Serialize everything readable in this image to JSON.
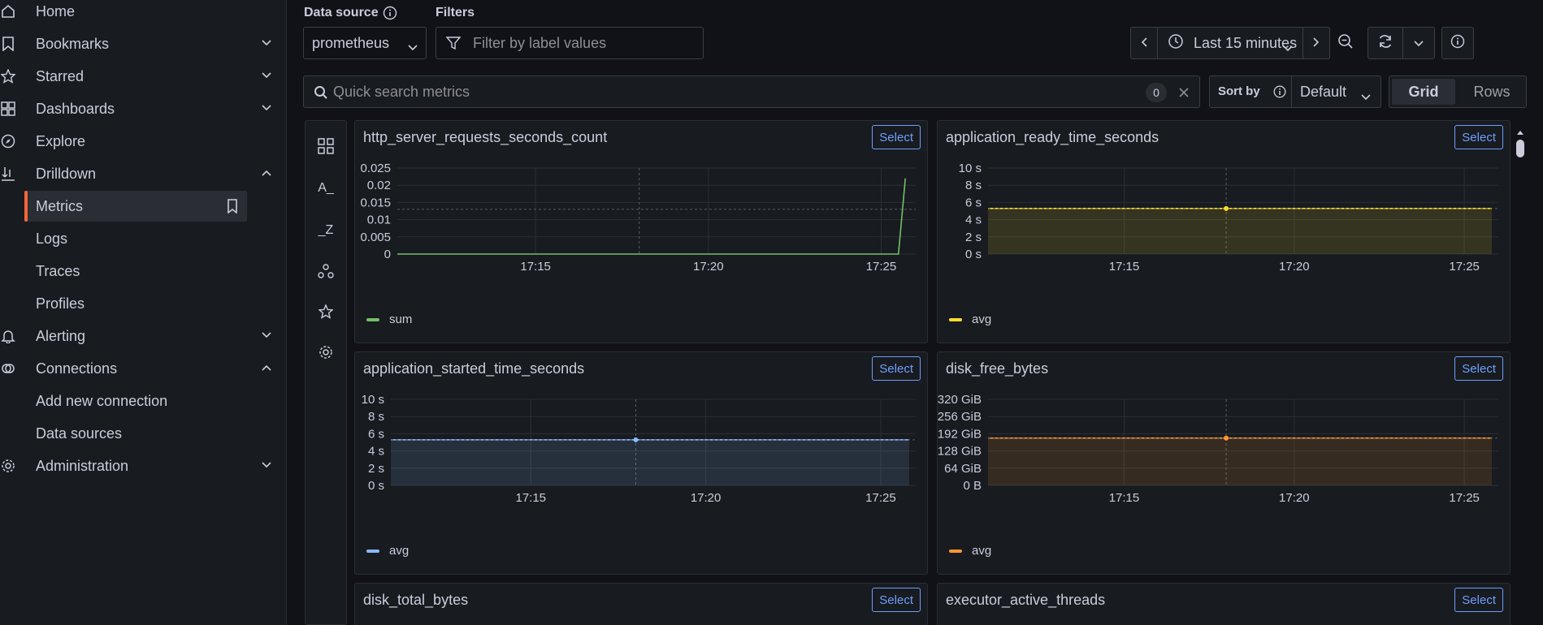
{
  "sidebar": {
    "items": [
      {
        "label": "Home",
        "icon": "home-icon"
      },
      {
        "label": "Bookmarks",
        "icon": "bookmark-icon"
      },
      {
        "label": "Starred",
        "icon": "star-icon"
      },
      {
        "label": "Dashboards",
        "icon": "dashboards-icon"
      },
      {
        "label": "Explore",
        "icon": "compass-icon"
      },
      {
        "label": "Drilldown",
        "icon": "drilldown-icon"
      },
      {
        "label": "Alerting",
        "icon": "bell-icon"
      },
      {
        "label": "Connections",
        "icon": "connections-icon"
      },
      {
        "label": "Administration",
        "icon": "gear-icon"
      }
    ],
    "drilldown_sub": [
      "Metrics",
      "Logs",
      "Traces",
      "Profiles"
    ],
    "connections_sub": [
      "Add new connection",
      "Data sources"
    ]
  },
  "toolbar": {
    "datasource_label": "Data source",
    "datasource_value": "prometheus",
    "filters_label": "Filters",
    "filters_placeholder": "Filter by label values",
    "time_range": "Last 15 minutes",
    "search_placeholder": "Quick search metrics",
    "search_count": "0",
    "sort_label": "Sort by",
    "sort_value": "Default",
    "view_grid": "Grid",
    "view_rows": "Rows"
  },
  "rail": {
    "icons": [
      "grid-icon",
      "a-to-z-icon",
      "z-to-a-icon",
      "group-icon",
      "star-icon",
      "settings-icon"
    ],
    "az_label": "A_",
    "za_label": "_Z"
  },
  "select_label": "Select",
  "colors": {
    "green": "#73bf69",
    "yellow": "#fade2a",
    "blue": "#8ab8ff",
    "orange": "#ff9830",
    "accent": "#f2663a"
  },
  "panels": [
    {
      "title": "http_server_requests_seconds_count",
      "legend": "sum",
      "color": "green",
      "chart_data": {
        "type": "line",
        "y_ticks": [
          "0.025",
          "0.02",
          "0.015",
          "0.01",
          "0.005",
          "0"
        ],
        "x_ticks": [
          "17:15",
          "17:20",
          "17:25"
        ],
        "series": [
          {
            "name": "sum",
            "x": [
              "17:11",
              "17:25.5",
              "17:25.7"
            ],
            "values": [
              0,
              0,
              0.022
            ]
          }
        ]
      }
    },
    {
      "title": "application_ready_time_seconds",
      "legend": "avg",
      "color": "yellow",
      "chart_data": {
        "type": "area",
        "y_ticks": [
          "10 s",
          "8 s",
          "6 s",
          "4 s",
          "2 s",
          "0 s"
        ],
        "x_ticks": [
          "17:15",
          "17:20",
          "17:25"
        ],
        "series": [
          {
            "name": "avg",
            "values": [
              5.3,
              5.3
            ]
          }
        ]
      }
    },
    {
      "title": "application_started_time_seconds",
      "legend": "avg",
      "color": "blue",
      "chart_data": {
        "type": "area",
        "y_ticks": [
          "10 s",
          "8 s",
          "6 s",
          "4 s",
          "2 s",
          "0 s"
        ],
        "x_ticks": [
          "17:15",
          "17:20",
          "17:25"
        ],
        "series": [
          {
            "name": "avg",
            "values": [
              5.3,
              5.3
            ]
          }
        ]
      }
    },
    {
      "title": "disk_free_bytes",
      "legend": "avg",
      "color": "orange",
      "chart_data": {
        "type": "area",
        "y_ticks": [
          "320 GiB",
          "256 GiB",
          "192 GiB",
          "128 GiB",
          "64 GiB",
          "0 B"
        ],
        "x_ticks": [
          "17:15",
          "17:20",
          "17:25"
        ],
        "series": [
          {
            "name": "avg",
            "values": [
              176,
              176
            ]
          }
        ]
      }
    },
    {
      "title": "disk_total_bytes"
    },
    {
      "title": "executor_active_threads"
    }
  ]
}
